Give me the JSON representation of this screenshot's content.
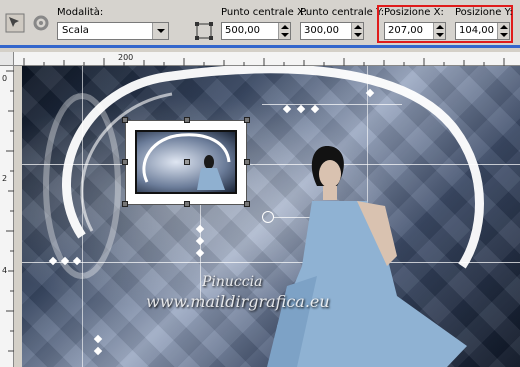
{
  "toolbar": {
    "mode_label": "Modalità:",
    "mode_value": "Scala",
    "center_x_label": "Punto centrale X:",
    "center_x_value": "500,00",
    "center_y_label": "Punto centrale Y:",
    "center_y_value": "300,00",
    "pos_x_label": "Posizione X:",
    "pos_x_value": "207,00",
    "pos_y_label": "Posizione Y:",
    "pos_y_value": "104,00"
  },
  "ruler": {
    "top_ticks": [
      "200"
    ],
    "left_ticks": [
      "0",
      "2",
      "4"
    ]
  },
  "watermark": {
    "name": "Pinuccia",
    "site": "www.maildirgrafica.eu"
  },
  "colors": {
    "highlight": "#e01b1b",
    "separator": "#3366cc"
  }
}
